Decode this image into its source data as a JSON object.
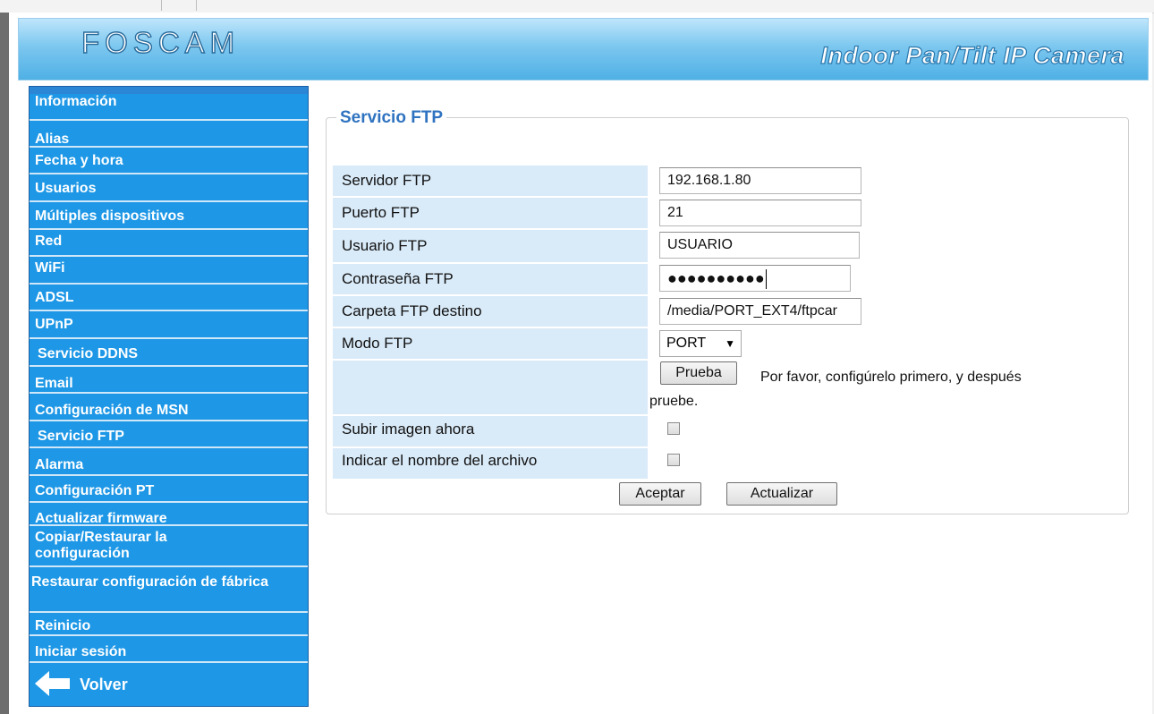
{
  "header": {
    "brand": "FOSCAM",
    "product": "Indoor Pan/Tilt IP Camera"
  },
  "sidebar": {
    "items": [
      {
        "label": "Información"
      },
      {
        "label": "Alias"
      },
      {
        "label": "Fecha y hora"
      },
      {
        "label": "Usuarios"
      },
      {
        "label": "Múltiples dispositivos"
      },
      {
        "label": "Red"
      },
      {
        "label": "WiFi"
      },
      {
        "label": "ADSL"
      },
      {
        "label": "UPnP"
      },
      {
        "label": "Servicio DDNS"
      },
      {
        "label": "Email"
      },
      {
        "label": "Configuración de MSN"
      },
      {
        "label": "Servicio FTP"
      },
      {
        "label": "Alarma"
      },
      {
        "label": "Configuración PT"
      },
      {
        "label": "Actualizar firmware"
      },
      {
        "label": "Copiar/Restaurar la configuración"
      },
      {
        "label": "Restaurar configuración de fábrica"
      },
      {
        "label": "Reinicio"
      },
      {
        "label": "Iniciar sesión"
      }
    ],
    "back_label": "Volver"
  },
  "ftp": {
    "legend": "Servicio FTP",
    "server_label": "Servidor FTP",
    "server_value": "192.168.1.80",
    "port_label": "Puerto FTP",
    "port_value": "21",
    "user_label": "Usuario FTP",
    "user_value": "USUARIO",
    "password_label": "Contraseña FTP",
    "password_value": "●●●●●●●●●●",
    "folder_label": "Carpeta FTP destino",
    "folder_value": "/media/PORT_EXT4/ftpcar",
    "mode_label": "Modo FTP",
    "mode_value": "PORT",
    "test_button": "Prueba",
    "test_hint_line1": "Por favor, configúrelo primero, y después",
    "test_hint_line2": "pruebe.",
    "upload_label": "Subir imagen ahora",
    "filename_label": "Indicar el nombre del archivo",
    "accept_button": "Aceptar",
    "refresh_button": "Actualizar"
  }
}
